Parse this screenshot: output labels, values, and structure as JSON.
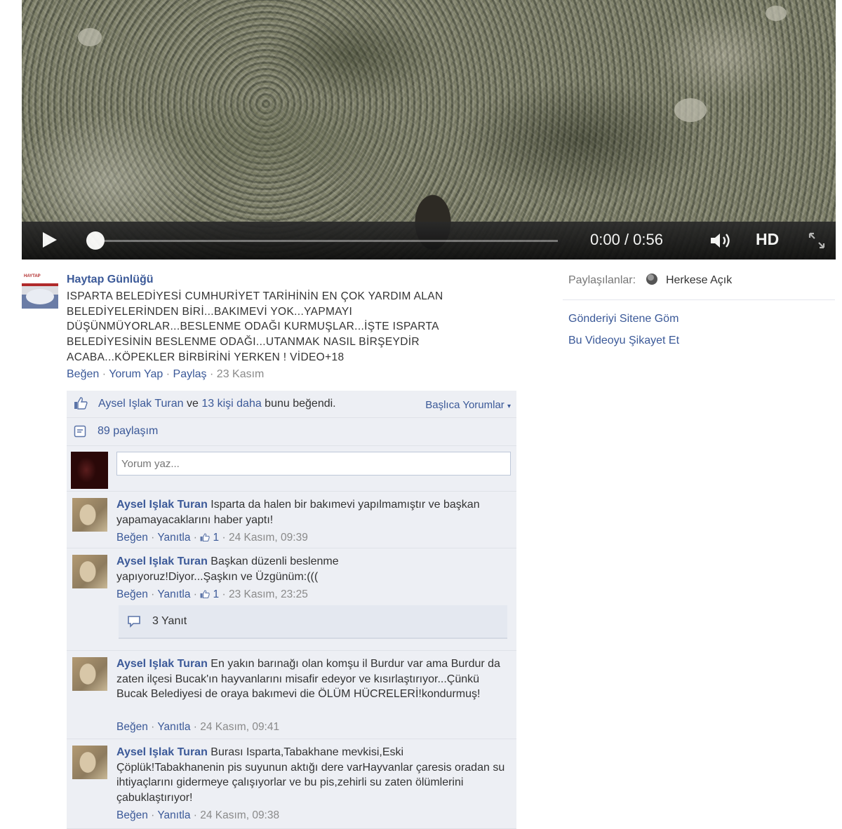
{
  "video": {
    "time": "0:00 / 0:56",
    "hd": "HD",
    "progress": 0
  },
  "post": {
    "author": "Haytap Günlüğü",
    "logo_text": "HAYTAP",
    "text": "ISPARTA BELEDİYESİ CUMHURİYET TARİHİNİN EN ÇOK YARDIM ALAN BELEDİYELERİNDEN BİRİ...BAKIMEVİ YOK...YAPMAYI DÜŞÜNMÜYORLAR...BESLENME ODAĞI KURMUŞLAR...İŞTE ISPARTA BELEDİYESİNİN BESLENME ODAĞI...UTANMAK NASIL BİRŞEYDİR ACABA...KÖPEKLER BİRBİRİNİ YERKEN ! VİDEO+18",
    "actions": {
      "like": "Beğen",
      "comment": "Yorum Yap",
      "share": "Paylaş",
      "date": "23 Kasım"
    }
  },
  "right": {
    "shared_with_label": "Paylaşılanlar:",
    "shared_with_value": "Herkese Açık",
    "embed_link": "Gönderiyi Sitene Göm",
    "report_link": "Bu Videoyu Şikayet Et"
  },
  "feedback": {
    "likes": {
      "person": "Aysel Işlak Turan",
      "connector": " ve ",
      "others": "13 kişi daha",
      "suffix": " bunu beğendi."
    },
    "top_comments": "Başlıca Yorumlar",
    "shares": "89 paylaşım",
    "comment_placeholder": "Yorum yaz...",
    "comments": [
      {
        "name": "Aysel Işlak Turan",
        "text": "Isparta da halen bir bakımevi yapılmamıştır ve başkan yapamayacaklarını haber yaptı!",
        "like": "Beğen",
        "reply": "Yanıtla",
        "like_count": "1",
        "date": "24 Kasım, 09:39"
      },
      {
        "name": "Aysel Işlak Turan",
        "text": "Başkan düzenli beslenme yapıyoruz!Diyor...Şaşkın ve Üzgünüm:(((",
        "like": "Beğen",
        "reply": "Yanıtla",
        "like_count": "1",
        "date": "23 Kasım, 23:25",
        "replies": "3 Yanıt"
      },
      {
        "name": "Aysel Işlak Turan",
        "text": "En yakın barınağı olan komşu il Burdur var ama Burdur da zaten ilçesi Bucak'ın hayvanlarını misafir edeyor ve kısırlaştırıyor...Çünkü Bucak Belediyesi de oraya bakımevi die ÖLÜM HÜCRELERİ!kondurmuş!",
        "like": "Beğen",
        "reply": "Yanıtla",
        "date": "24 Kasım, 09:41"
      },
      {
        "name": "Aysel Işlak Turan",
        "text": "Burası Isparta,Tabakhane mevkisi,Eski Çöplük!Tabakhanenin pis suyunun aktığı dere varHayvanlar çaresis oradan su ihtiyaçlarını gidermeye çalışıyorlar ve bu pis,zehirli su zaten ölümlerini çabuklaştırıyor!",
        "like": "Beğen",
        "reply": "Yanıtla",
        "date": "24 Kasım, 09:38"
      }
    ]
  }
}
